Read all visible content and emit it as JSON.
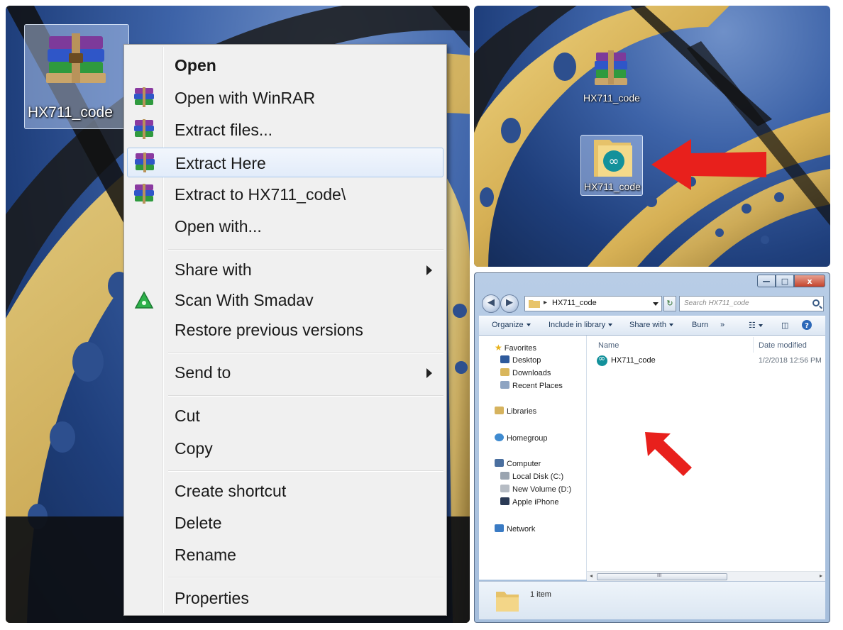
{
  "desktop": {
    "archive_icon": "winrar-archive-icon",
    "archive_label": "HX711_code"
  },
  "context_menu": {
    "items": [
      {
        "label": "Open",
        "icon": "",
        "bold": true
      },
      {
        "label": "Open with WinRAR",
        "icon": "winrar-icon"
      },
      {
        "label": "Extract files...",
        "icon": "winrar-icon"
      },
      {
        "label": "Extract Here",
        "icon": "winrar-icon",
        "highlighted": true
      },
      {
        "label": "Extract to HX711_code\\",
        "icon": "winrar-icon"
      },
      {
        "label": "Open with..."
      },
      {
        "label": "Share with",
        "submenu": true
      },
      {
        "label": "Scan With Smadav",
        "icon": "smadav-icon"
      },
      {
        "label": "Restore previous versions"
      },
      {
        "label": "Send to",
        "submenu": true
      },
      {
        "label": "Cut"
      },
      {
        "label": "Copy"
      },
      {
        "label": "Create shortcut"
      },
      {
        "label": "Delete"
      },
      {
        "label": "Rename"
      },
      {
        "label": "Properties"
      }
    ]
  },
  "extracted": {
    "archive_label": "HX711_code",
    "folder_label": "HX711_code",
    "folder_icon": "arduino-folder-icon",
    "arrow_color": "#e8201c"
  },
  "explorer": {
    "window_buttons": {
      "minimize": "—",
      "maximize": "□",
      "close": "x"
    },
    "back_icon": "◀",
    "forward_icon": "▶",
    "address_path": "HX711_code",
    "search_placeholder": "Search HX711_code",
    "toolbar": {
      "organize": "Organize",
      "include_in_library": "Include in library",
      "share_with": "Share with",
      "burn": "Burn",
      "more": "»"
    },
    "nav": {
      "favorites": "Favorites",
      "desktop": "Desktop",
      "downloads": "Downloads",
      "recent_places": "Recent Places",
      "libraries": "Libraries",
      "homegroup": "Homegroup",
      "computer": "Computer",
      "local_disk": "Local Disk (C:)",
      "new_volume": "New Volume (D:)",
      "apple_iphone": "Apple iPhone",
      "network": "Network"
    },
    "columns": {
      "name": "Name",
      "date_modified": "Date modified"
    },
    "files": [
      {
        "name": "HX711_code",
        "date": "1/2/2018 12:56 PM",
        "icon": "arduino-file-icon"
      }
    ],
    "scroll_thumb": "III",
    "status_count": "1 item"
  }
}
